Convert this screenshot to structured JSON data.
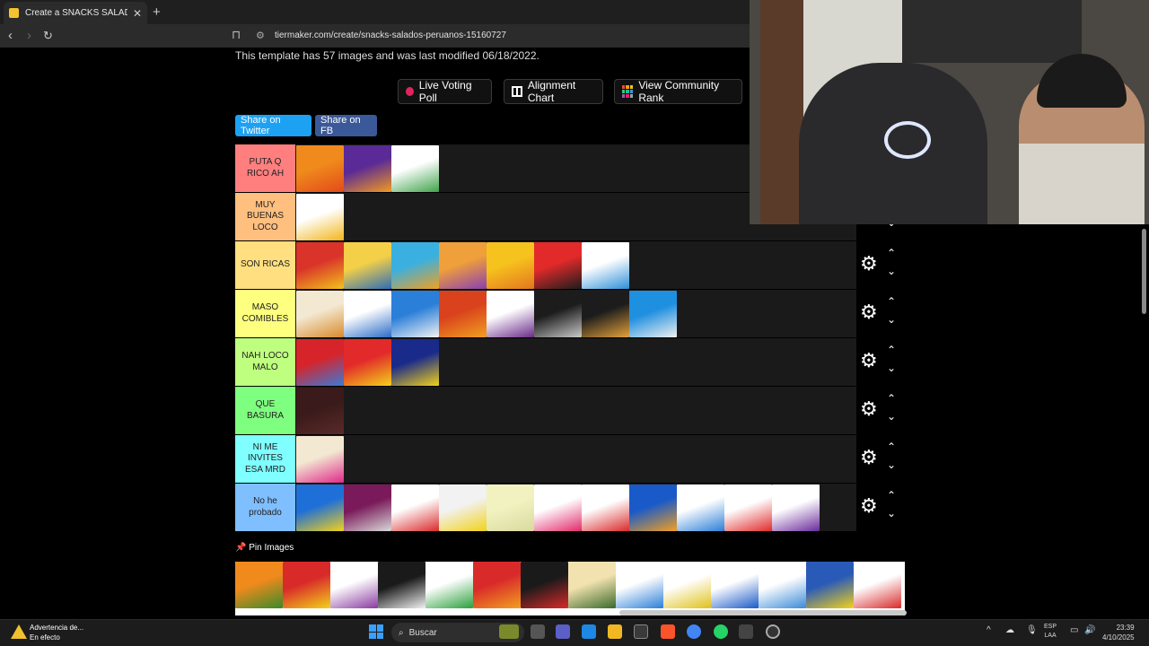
{
  "browser": {
    "tab_title": "Create a SNACKS SALADOS PER",
    "url": "tiermaker.com/create/snacks-salados-peruanos-15160727"
  },
  "page": {
    "template_info": "This template has 57 images and was last modified 06/18/2022.",
    "buttons": {
      "live_voting": "Live Voting Poll",
      "alignment_chart": "Alignment Chart",
      "community_rank": "View Community Rank",
      "share_twitter": "Share on Twitter",
      "share_fb": "Share on FB"
    },
    "tiers": [
      {
        "label": "PUTA Q\nRICO AH",
        "color": "#ff7f7f",
        "images": [
          [
            "#f08a1c",
            "#e34a1a"
          ],
          [
            "#5a2a96",
            "#f29a20"
          ],
          [
            "#ffffff",
            "#3fa34a"
          ]
        ]
      },
      {
        "label": "MUY\nBUENAS\nLOCO",
        "color": "#ffbf7f",
        "images": [
          [
            "#ffffff",
            "#f2b51a"
          ]
        ]
      },
      {
        "label": "SON RICAS",
        "color": "#ffdf7f",
        "images": [
          [
            "#d9332a",
            "#f3c21c"
          ],
          [
            "#f4d049",
            "#2d6eb5"
          ],
          [
            "#3ab0e0",
            "#f0a020"
          ],
          [
            "#f0a03a",
            "#8a3fb0"
          ],
          [
            "#f6c21d",
            "#e3761e"
          ],
          [
            "#e32a2a",
            "#1c1c1c"
          ],
          [
            "#ffffff",
            "#2d8fd8"
          ]
        ]
      },
      {
        "label": "MASO\nCOMIBLES",
        "color": "#ffff7f",
        "images": [
          [
            "#f3e9d2",
            "#d98a2a"
          ],
          [
            "#ffffff",
            "#2a6cc8"
          ],
          [
            "#2a7fd8",
            "#f3f3f3"
          ],
          [
            "#d9421c",
            "#f0a020"
          ],
          [
            "#ffffff",
            "#6a2a8a"
          ],
          [
            "#1c1c1c",
            "#c9c9c9"
          ],
          [
            "#1c1c1c",
            "#e3a13a"
          ],
          [
            "#1f8fe0",
            "#f0f0f0"
          ]
        ]
      },
      {
        "label": "NAH LOCO\nMALO",
        "color": "#bfff7f",
        "images": [
          [
            "#d6242a",
            "#3a7ad8"
          ],
          [
            "#e22a2a",
            "#f2d21a"
          ],
          [
            "#1a2a8a",
            "#f2d21a"
          ]
        ]
      },
      {
        "label": "QUE\nBASURA",
        "color": "#7fff7f",
        "images": [
          [
            "#3a1a1a",
            "#5a2a2a"
          ]
        ]
      },
      {
        "label": "NI ME\nINVITES\nESA MRD",
        "color": "#7fffff",
        "images": [
          [
            "#f3e9d2",
            "#e02a8a"
          ]
        ]
      },
      {
        "label": "No he\nprobado",
        "color": "#7fbfff",
        "images": [
          [
            "#1f6fd8",
            "#f2d21a"
          ],
          [
            "#7a1a5a",
            "#d9d9d9"
          ],
          [
            "#ffffff",
            "#d92a2a"
          ],
          [
            "#f2f2f2",
            "#f2d21a"
          ],
          [
            "#f2f2c0",
            "#d9d9a0"
          ],
          [
            "#ffffff",
            "#e02a6a"
          ],
          [
            "#ffffff",
            "#d92a2a"
          ],
          [
            "#1a5ac8",
            "#f2a020"
          ],
          [
            "#ffffff",
            "#2a7fd8"
          ],
          [
            "#ffffff",
            "#e02a2a"
          ],
          [
            "#ffffff",
            "#6a2a9a"
          ]
        ]
      }
    ],
    "pin_label": "Pin Images",
    "pin_images": [
      [
        "#f08a1c",
        "#3a8a2a"
      ],
      [
        "#d92a2a",
        "#f2d21a"
      ],
      [
        "#ffffff",
        "#8a3aa0"
      ],
      [
        "#1a1a1a",
        "#f2f2f2"
      ],
      [
        "#ffffff",
        "#2aa03a"
      ],
      [
        "#d92a2a",
        "#f2a020"
      ],
      [
        "#1a1a1a",
        "#d92a2a"
      ],
      [
        "#f2e2b0",
        "#3a6a2a"
      ],
      [
        "#ffffff",
        "#2a7fd8"
      ],
      [
        "#ffffff",
        "#e0c21a"
      ],
      [
        "#ffffff",
        "#1a5ac8"
      ],
      [
        "#ffffff",
        "#3a8ad8"
      ],
      [
        "#2a5ab8",
        "#f2d21a"
      ],
      [
        "#ffffff",
        "#d92a2a"
      ]
    ]
  },
  "taskbar": {
    "warning_title": "Advertencia de...",
    "warning_status": "En efecto",
    "search_placeholder": "Buscar",
    "lang1": "ESP",
    "lang2": "LAA",
    "time": "23:39",
    "date": "4/10/2025"
  },
  "colors": {
    "twitter": "#1da1f2",
    "facebook": "#3b5998"
  }
}
